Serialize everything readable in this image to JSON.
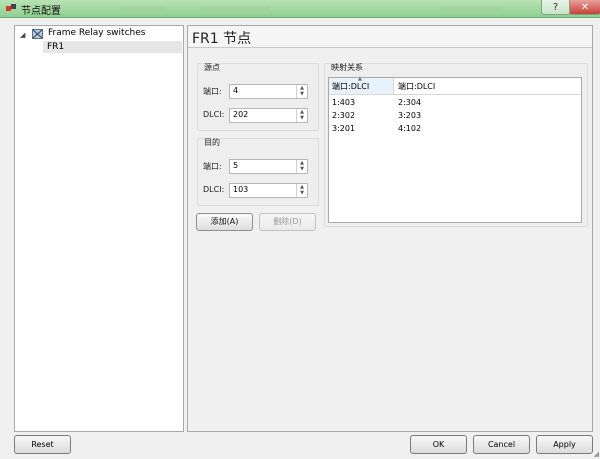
{
  "window": {
    "title": "节点配置",
    "help": "?",
    "close": "✕"
  },
  "tree": {
    "root": {
      "label": "Frame Relay switches",
      "expanded": true
    },
    "children": [
      {
        "label": "FR1",
        "selected": true
      }
    ]
  },
  "node": {
    "title": "FR1 节点"
  },
  "source": {
    "group_label": "源点",
    "port_label": "端口:",
    "port_value": "4",
    "dlci_label": "DLCI:",
    "dlci_value": "202"
  },
  "destination": {
    "group_label": "目的",
    "port_label": "端口:",
    "port_value": "5",
    "dlci_label": "DLCI:",
    "dlci_value": "103"
  },
  "actions": {
    "add": "添加(A)",
    "delete": "删除(D)"
  },
  "mapping": {
    "group_label": "映射关系",
    "columns": [
      "端口:DLCI",
      "端口:DLCI"
    ],
    "rows": [
      [
        "1:403",
        "2:304"
      ],
      [
        "2:302",
        "3:203"
      ],
      [
        "3:201",
        "4:102"
      ]
    ]
  },
  "footer": {
    "reset": "Reset",
    "ok": "OK",
    "cancel": "Cancel",
    "apply": "Apply"
  },
  "colors": {
    "titlebar": "#9dd89c",
    "close": "#c9413a",
    "selection": "#e6e6e6"
  }
}
